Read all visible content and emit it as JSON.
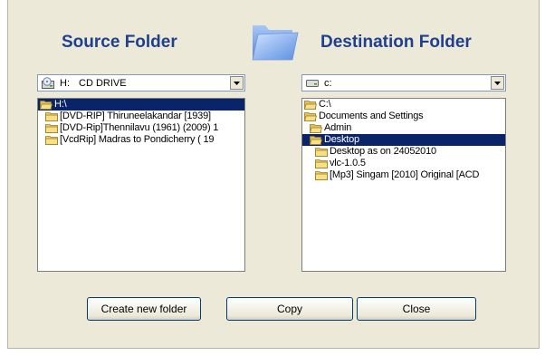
{
  "source": {
    "heading": "Source Folder",
    "drive_letter": "H:",
    "drive_label": "CD DRIVE",
    "items": [
      {
        "label": "H:\\",
        "selected": true,
        "indent": 0,
        "open": true
      },
      {
        "label": "[DVD-RIP] Thiruneelakandar [1939]",
        "selected": false,
        "indent": 1
      },
      {
        "label": "[DVD-Rip]Thennilavu (1961) (2009) 1",
        "selected": false,
        "indent": 1
      },
      {
        "label": "[VcdRip] Madras to Pondicherry ( 19",
        "selected": false,
        "indent": 1
      }
    ]
  },
  "destination": {
    "heading": "Destination Folder",
    "drive": "c:",
    "items": [
      {
        "label": "C:\\",
        "selected": false,
        "indent": 0,
        "open": true
      },
      {
        "label": "Documents and Settings",
        "selected": false,
        "indent": 0,
        "open": true
      },
      {
        "label": "Admin",
        "selected": false,
        "indent": 1,
        "open": true
      },
      {
        "label": "Desktop",
        "selected": true,
        "indent": 1,
        "open": true
      },
      {
        "label": "Desktop as on 24052010",
        "selected": false,
        "indent": 2
      },
      {
        "label": "vlc-1.0.5",
        "selected": false,
        "indent": 2
      },
      {
        "label": "[Mp3] Singam [2010] Original [ACD",
        "selected": false,
        "indent": 2
      }
    ]
  },
  "buttons": {
    "create": "Create new folder",
    "copy": "Copy",
    "close": "Close"
  },
  "colors": {
    "heading": "#1f3f8f",
    "selection": "#0a246a",
    "dialog_bg": "#ece9d8"
  }
}
